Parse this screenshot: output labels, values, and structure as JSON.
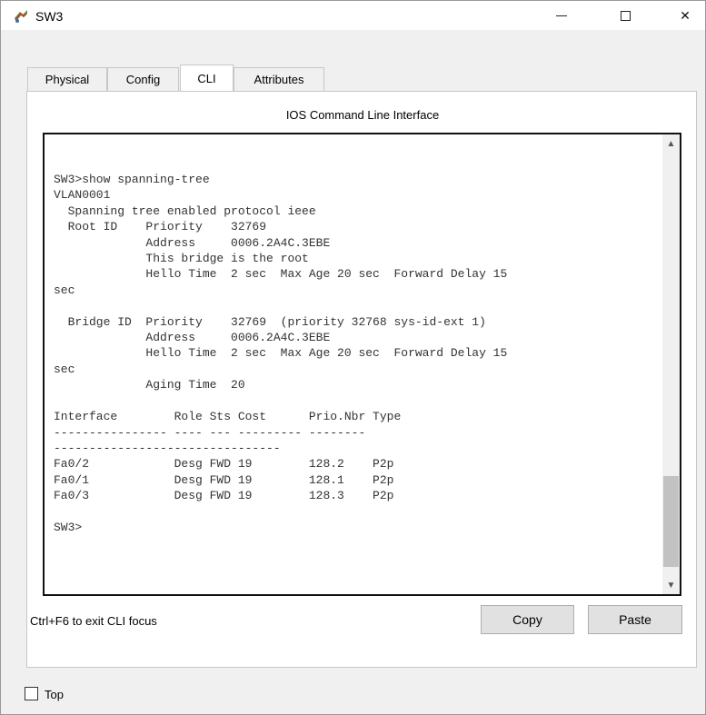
{
  "window": {
    "title": "SW3",
    "icon": "switch-app-icon",
    "controls": {
      "minimize": "minimize-icon",
      "maximize": "maximize-icon",
      "close": "✕"
    }
  },
  "tabs": [
    {
      "label": "Physical",
      "active": false
    },
    {
      "label": "Config",
      "active": false
    },
    {
      "label": "CLI",
      "active": true
    },
    {
      "label": "Attributes",
      "active": false
    }
  ],
  "cli": {
    "heading": "IOS Command Line Interface",
    "lines": [
      "SW3>show spanning-tree",
      "VLAN0001",
      "  Spanning tree enabled protocol ieee",
      "  Root ID    Priority    32769",
      "             Address     0006.2A4C.3EBE",
      "             This bridge is the root",
      "             Hello Time  2 sec  Max Age 20 sec  Forward Delay 15",
      "sec",
      "",
      "  Bridge ID  Priority    32769  (priority 32768 sys-id-ext 1)",
      "             Address     0006.2A4C.3EBE",
      "             Hello Time  2 sec  Max Age 20 sec  Forward Delay 15",
      "sec",
      "             Aging Time  20",
      "",
      "Interface        Role Sts Cost      Prio.Nbr Type",
      "---------------- ---- --- --------- --------",
      "--------------------------------",
      "Fa0/2            Desg FWD 19        128.2    P2p",
      "Fa0/1            Desg FWD 19        128.1    P2p",
      "Fa0/3            Desg FWD 19        128.3    P2p",
      "",
      "SW3>"
    ],
    "exit_hint": "Ctrl+F6 to exit CLI focus",
    "copy_label": "Copy",
    "paste_label": "Paste"
  },
  "footer": {
    "top_label": "Top",
    "top_checked": false
  }
}
